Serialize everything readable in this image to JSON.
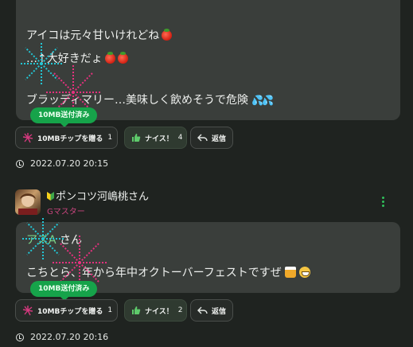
{
  "post1": {
    "line1": "アイコは元々甘いけれどね",
    "line2": "…↑大好きだょ",
    "line3": "ブラッディマリー…美味しく飲めそうで危険",
    "sent_badge": "10MB送付済み",
    "chip_label": "10MBチップを贈る",
    "chip_count": "1",
    "nice_label": "ナイス！",
    "nice_count": "4",
    "reply_label": "返信",
    "timestamp": "2022.07.20 20:15"
  },
  "post2": {
    "user_name": "ポンコツ河嶋桃さん",
    "user_rank": "Gマスター",
    "mention": "アズA",
    "mention_suffix": " さん",
    "line2": "こちとら、年から年中オクトーバーフェストですぜ",
    "sent_badge": "10MB送付済み",
    "chip_label": "10MBチップを贈る",
    "chip_count": "1",
    "nice_label": "ナイス！",
    "nice_count": "2",
    "reply_label": "返信",
    "timestamp": "2022.07.20 20:16"
  },
  "colors": {
    "background": "#1f2320",
    "bubble": "#3a3e3b",
    "accent_green": "#16a34a",
    "rank_pink": "#c7457d",
    "mention_green": "#7ad38a"
  },
  "icons": [
    "tomato-emoji",
    "sweat-drops-emoji",
    "beer-emoji",
    "grin-emoji",
    "firework-chip-icon",
    "thumbs-up-icon",
    "reply-arrow-icon",
    "clock-icon",
    "beginner-leaf-icon",
    "kebab-menu-icon"
  ]
}
